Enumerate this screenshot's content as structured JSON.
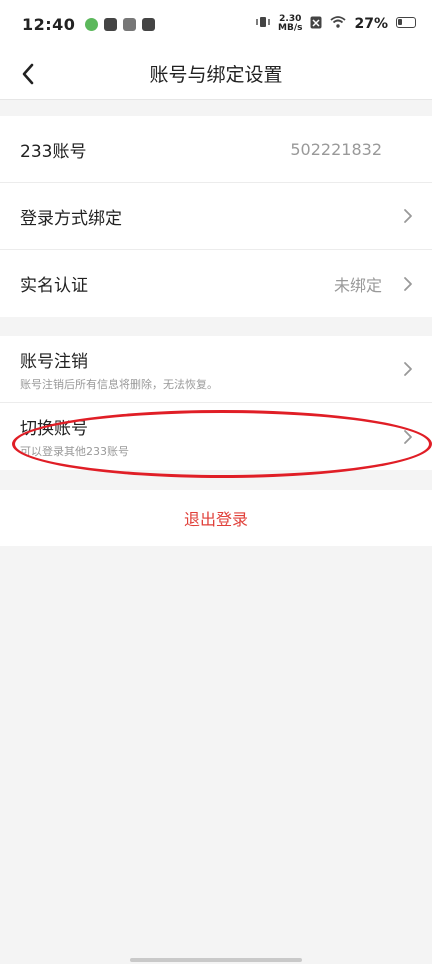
{
  "status_bar": {
    "time": "12:40",
    "net_speed_value": "2.30",
    "net_speed_unit": "MB/s",
    "battery_percent": "27%"
  },
  "header": {
    "title": "账号与绑定设置"
  },
  "account_group": {
    "rows": [
      {
        "label": "233账号",
        "value": "502221832"
      },
      {
        "label": "登录方式绑定"
      },
      {
        "label": "实名认证",
        "value": "未绑定"
      }
    ]
  },
  "account_actions": {
    "rows": [
      {
        "label": "账号注销",
        "sub": "账号注销后所有信息将删除，无法恢复。"
      },
      {
        "label": "切换账号",
        "sub": "可以登录其他233账号"
      }
    ]
  },
  "logout": {
    "label": "退出登录"
  },
  "colors": {
    "accent_red": "#e0403a",
    "highlight_red": "#e01e26"
  }
}
